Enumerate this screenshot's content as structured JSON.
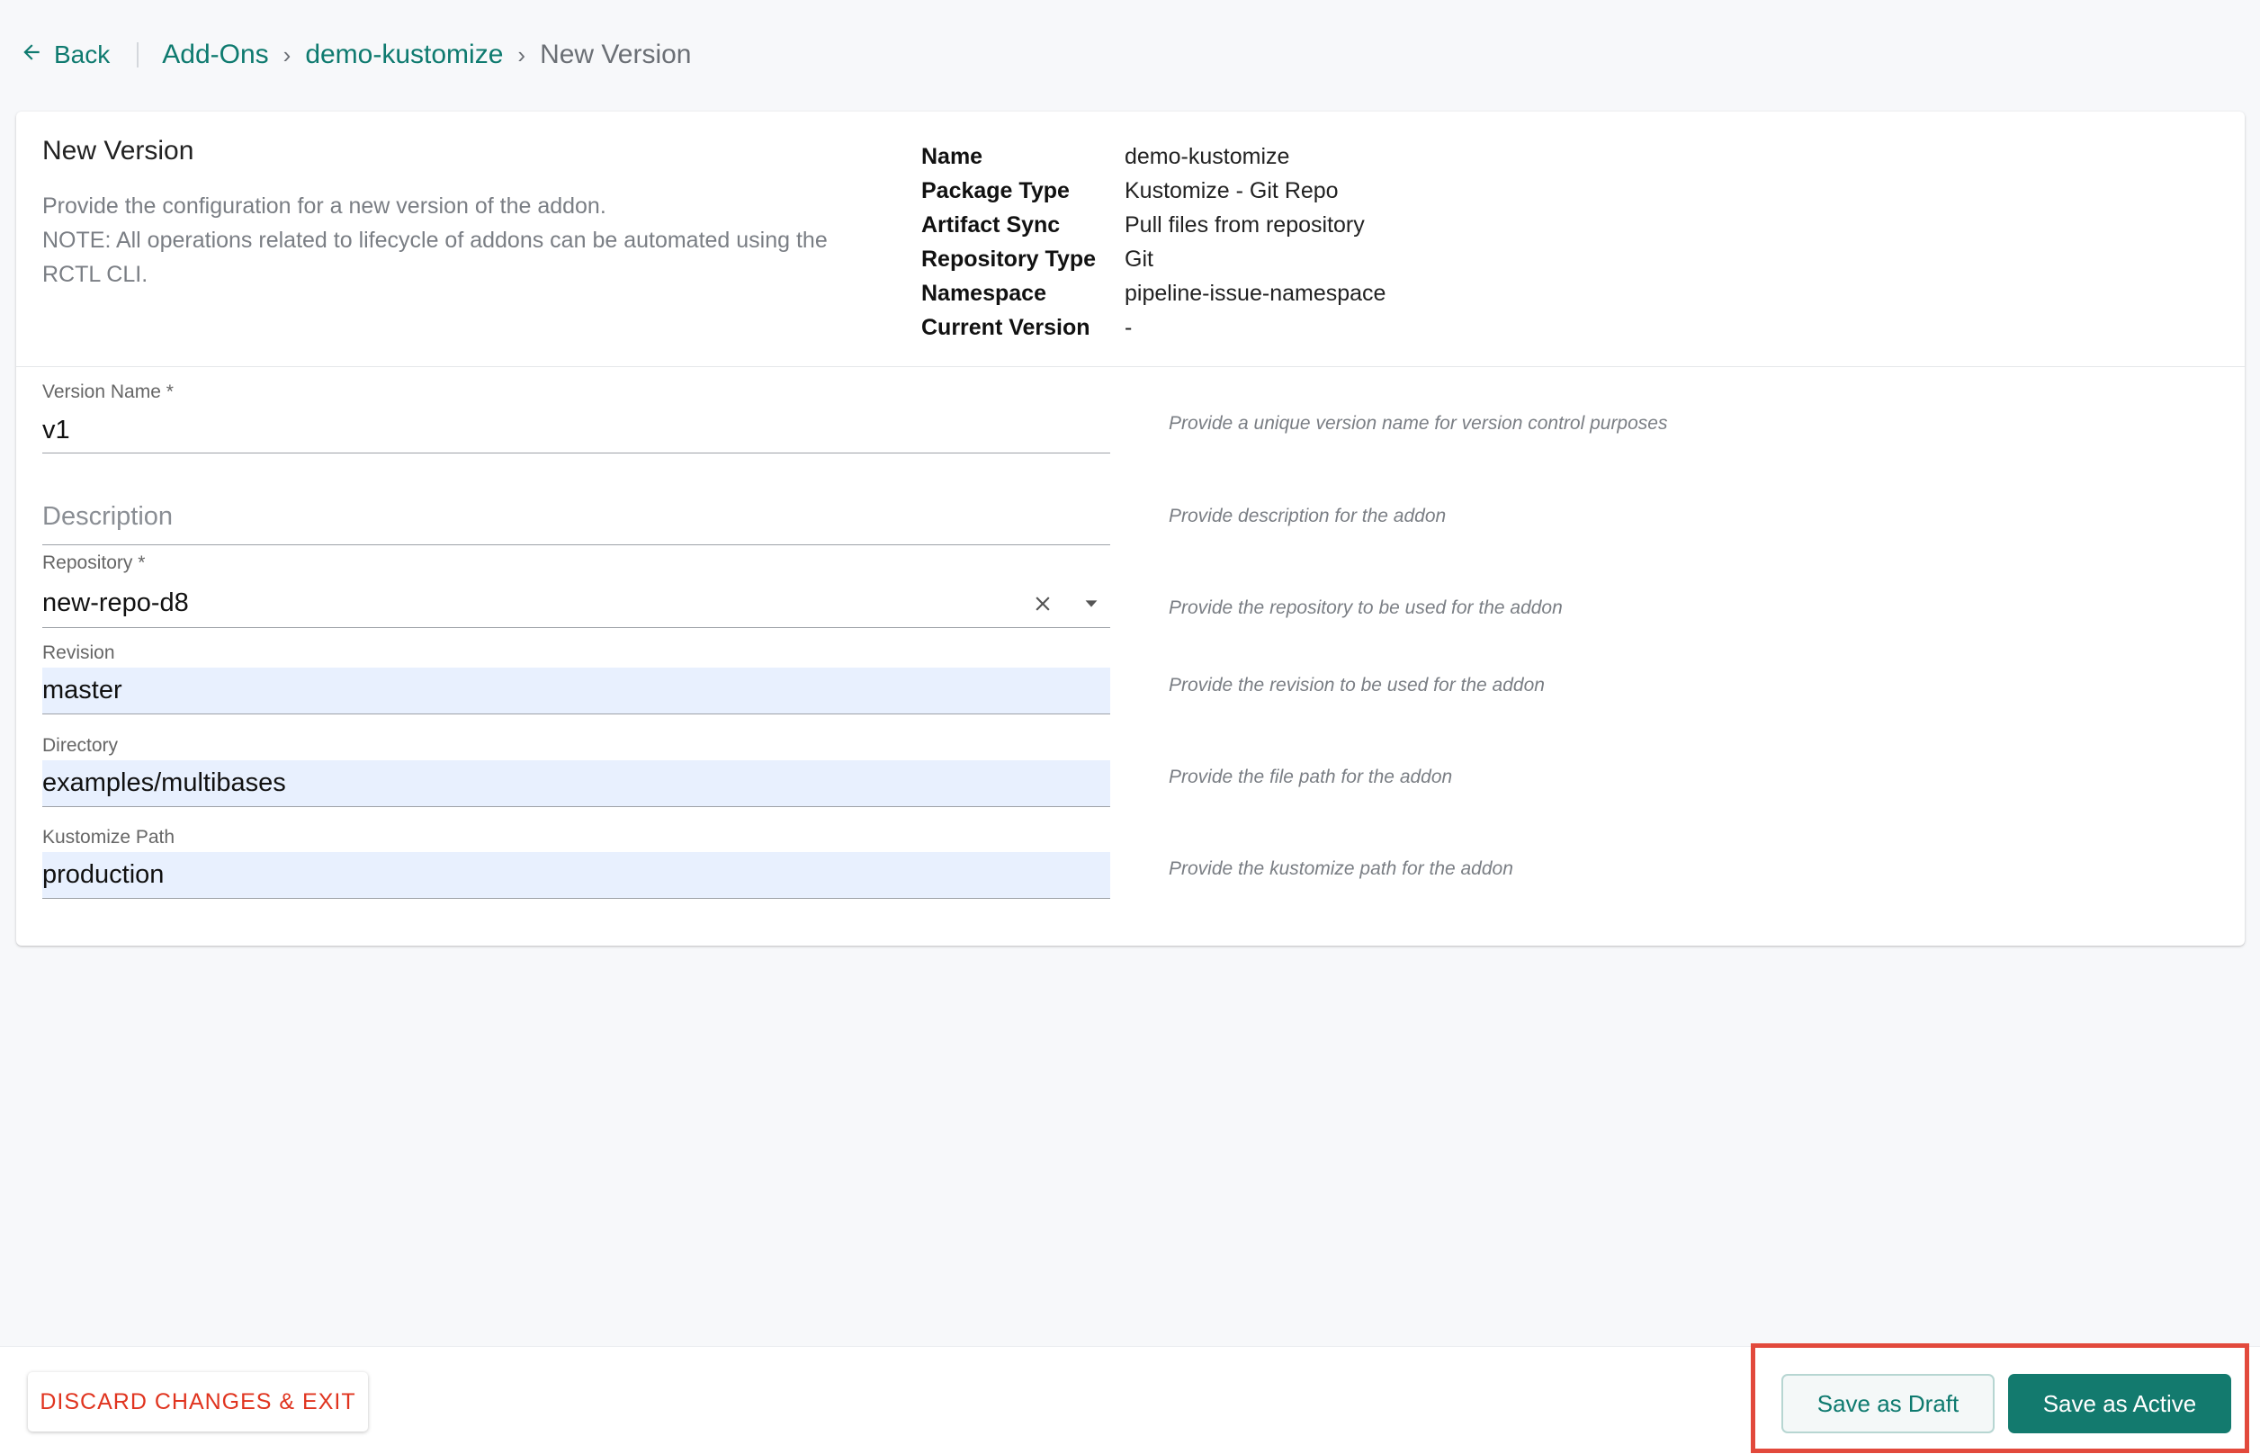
{
  "header": {
    "back_label": "Back",
    "breadcrumbs": [
      "Add-Ons",
      "demo-kustomize",
      "New Version"
    ]
  },
  "card": {
    "title": "New Version",
    "description_line1": "Provide the configuration for a new version of the addon.",
    "description_line2": "NOTE: All operations related to lifecycle of addons can be automated using the RCTL CLI.",
    "meta": [
      {
        "key": "Name",
        "value": "demo-kustomize"
      },
      {
        "key": "Package Type",
        "value": "Kustomize - Git Repo"
      },
      {
        "key": "Artifact Sync",
        "value": "Pull files from repository"
      },
      {
        "key": "Repository Type",
        "value": "Git"
      },
      {
        "key": "Namespace",
        "value": "pipeline-issue-namespace"
      },
      {
        "key": "Current Version",
        "value": "-"
      }
    ]
  },
  "form": {
    "version_name": {
      "label": "Version Name *",
      "value": "v1",
      "hint": "Provide a unique version name for version control purposes"
    },
    "description": {
      "placeholder": "Description",
      "hint": "Provide description for the addon"
    },
    "repository": {
      "label": "Repository *",
      "value": "new-repo-d8",
      "hint": "Provide the repository to be used for the addon"
    },
    "revision": {
      "label": "Revision",
      "value": "master",
      "hint": "Provide the revision to be used for the addon"
    },
    "directory": {
      "label": "Directory",
      "value": "examples/multibases",
      "hint": "Provide the file path for the addon"
    },
    "kustomize_path": {
      "label": "Kustomize Path",
      "value": "production",
      "hint": "Provide the kustomize path for the addon"
    }
  },
  "footer": {
    "discard_label": "DISCARD CHANGES & EXIT",
    "draft_label": "Save as Draft",
    "active_label": "Save as Active"
  },
  "colors": {
    "accent": "#0e7a6f",
    "primary_button": "#137a6e",
    "danger": "#e0341f",
    "highlight": "#e2493c",
    "filled_input": "#e8f0fe"
  }
}
